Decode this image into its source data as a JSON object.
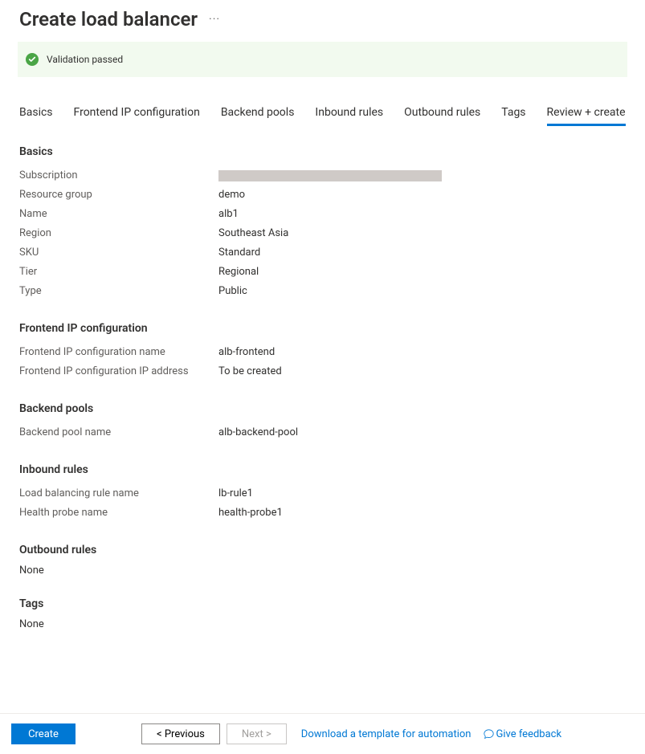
{
  "header": {
    "title": "Create load balancer"
  },
  "banner": {
    "text": "Validation passed"
  },
  "tabs": [
    {
      "label": "Basics"
    },
    {
      "label": "Frontend IP configuration"
    },
    {
      "label": "Backend pools"
    },
    {
      "label": "Inbound rules"
    },
    {
      "label": "Outbound rules"
    },
    {
      "label": "Tags"
    },
    {
      "label": "Review + create"
    }
  ],
  "sections": {
    "basics": {
      "heading": "Basics",
      "rows": {
        "subscription_label": "Subscription",
        "resource_group_label": "Resource group",
        "resource_group_value": "demo",
        "name_label": "Name",
        "name_value": "alb1",
        "region_label": "Region",
        "region_value": "Southeast Asia",
        "sku_label": "SKU",
        "sku_value": "Standard",
        "tier_label": "Tier",
        "tier_value": "Regional",
        "type_label": "Type",
        "type_value": "Public"
      }
    },
    "frontend": {
      "heading": "Frontend IP configuration",
      "name_label": "Frontend IP configuration name",
      "name_value": "alb-frontend",
      "ip_label": "Frontend IP configuration IP address",
      "ip_value": "To be created"
    },
    "backend": {
      "heading": "Backend pools",
      "name_label": "Backend pool name",
      "name_value": "alb-backend-pool"
    },
    "inbound": {
      "heading": "Inbound rules",
      "lb_rule_label": "Load balancing rule name",
      "lb_rule_value": "lb-rule1",
      "probe_label": "Health probe name",
      "probe_value": "health-probe1"
    },
    "outbound": {
      "heading": "Outbound rules",
      "body": "None"
    },
    "tags": {
      "heading": "Tags",
      "body": "None"
    }
  },
  "footer": {
    "create": "Create",
    "previous": "< Previous",
    "next": "Next >",
    "download": "Download a template for automation",
    "feedback": "Give feedback"
  }
}
